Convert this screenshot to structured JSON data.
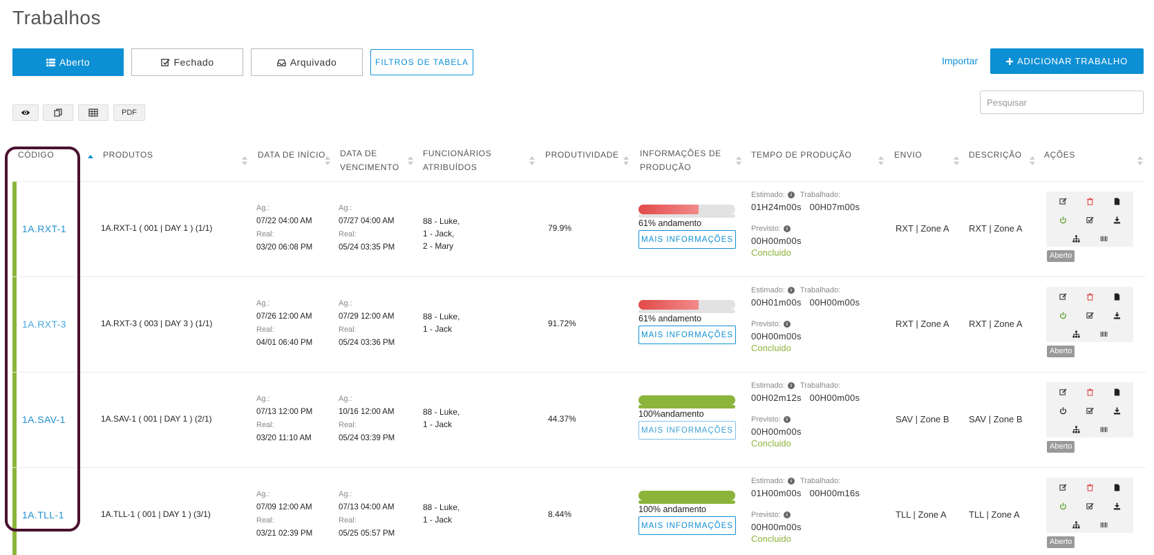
{
  "page": {
    "title": "Trabalhos"
  },
  "tabs": [
    {
      "label": "Aberto",
      "icon": "list-icon",
      "active": true
    },
    {
      "label": "Fechado",
      "icon": "check-square-icon",
      "active": false
    },
    {
      "label": "Arquivado",
      "icon": "inbox-icon",
      "active": false
    }
  ],
  "filter_label": "FILTROS DE TABELA",
  "import_label": "Importar",
  "add_label": "ADICIONAR TRABALHO",
  "toolbar": {
    "pdf_label": "PDF",
    "icons": [
      "eye-icon",
      "copy-icon",
      "table-icon"
    ]
  },
  "search": {
    "placeholder": "Pesquisar"
  },
  "columns": [
    "CÓDIGO",
    "PRODUTOS",
    "DATA DE INÍCIO",
    "DATA DE VENCIMENTO",
    "FUNCIONÁRIOS ATRIBUÍDOS",
    "PRODUTIVIDADE",
    "INFORMAÇÕES DE PRODUÇÃO",
    "TEMPO DE PRODUÇÃO",
    "ENVIO",
    "DESCRIÇÃO",
    "AÇÕES"
  ],
  "labels": {
    "ag": "Ag.:",
    "real": "Real:",
    "estimado": "Estimado:",
    "trabalhado": "Trabalhado:",
    "previsto": "Previsto:",
    "more_info": "MAIS INFORMAÇÕES"
  },
  "colors": {
    "accent": "#0d8fd4",
    "row_bar": "#8bb43a",
    "progress_low": "#e24a4a",
    "progress_full": "#8bb43a",
    "highlight": "#4a1030"
  },
  "rows": [
    {
      "code": "1A.RXT-1",
      "product": "1A.RXT-1 ( 001 | DAY 1 ) (1/1)",
      "start_ag": "07/22  04:00 AM",
      "start_real": "03/20  06:08 PM",
      "due_ag": "07/27  04:00 AM",
      "due_real": "05/24  03:35 PM",
      "employees": [
        "88 - Luke,",
        "1 - Jack,",
        "2 - Mary"
      ],
      "productivity": "79.9%",
      "progress_pct": 61,
      "progress_label": "61% andamento",
      "estimado": "01H24m00s",
      "trabalhado": "00H07m00s",
      "previsto": "00H00m00s",
      "concluido": "Concluido",
      "ship": "RXT | Zone A",
      "desc": "RXT | Zone A",
      "status": "Aberto"
    },
    {
      "code": "1A.RXT-3",
      "product": "1A.RXT-3 ( 003 | DAY 3 ) (1/1)",
      "start_ag": "07/26  12:00 AM",
      "start_real": "04/01  06:40 PM",
      "due_ag": "07/29  12:00 AM",
      "due_real": "05/24  03:36 PM",
      "employees": [
        "88 - Luke,",
        "1 - Jack"
      ],
      "productivity": "91.72%",
      "progress_pct": 61,
      "progress_label": "61% andamento",
      "estimado": "00H01m00s",
      "trabalhado": "00H00m00s",
      "previsto": "00H00m00s",
      "concluido": "Concluido",
      "ship": "RXT | Zone A",
      "desc": "RXT | Zone A",
      "status": "Aberto"
    },
    {
      "code": "1A.SAV-1",
      "product": "1A.SAV-1 ( 001 | DAY 1 ) (2/1)",
      "start_ag": "07/13  12:00 PM",
      "start_real": "03/20  11:10 AM",
      "due_ag": "10/16  12:00 AM",
      "due_real": "05/24  03:39 PM",
      "employees": [
        "88 - Luke,",
        "1 - Jack"
      ],
      "productivity": "44.37%",
      "progress_pct": 100,
      "progress_label": "100%andamento",
      "estimado": "00H02m12s",
      "trabalhado": "00H00m00s",
      "previsto": "00H00m00s",
      "concluido": "Concluido",
      "ship": "SAV | Zone B",
      "desc": "SAV | Zone B",
      "status": "Aberto"
    },
    {
      "code": "1A.TLL-1",
      "product": "1A.TLL-1 ( 001 | DAY 1 ) (3/1)",
      "start_ag": "07/09  12:00 AM",
      "start_real": "03/21  02:39 PM",
      "due_ag": "07/13  04:00 AM",
      "due_real": "05/25  05:57 PM",
      "employees": [
        "88 - Luke,",
        "1 - Jack"
      ],
      "productivity": "8.44%",
      "progress_pct": 100,
      "progress_label": "100% andamento",
      "estimado": "01H00m00s",
      "trabalhado": "00H00m16s",
      "previsto": "00H00m00s",
      "concluido": "Concluido",
      "ship": "TLL | Zone A",
      "desc": "TLL | Zone A",
      "status": "Aberto"
    }
  ]
}
